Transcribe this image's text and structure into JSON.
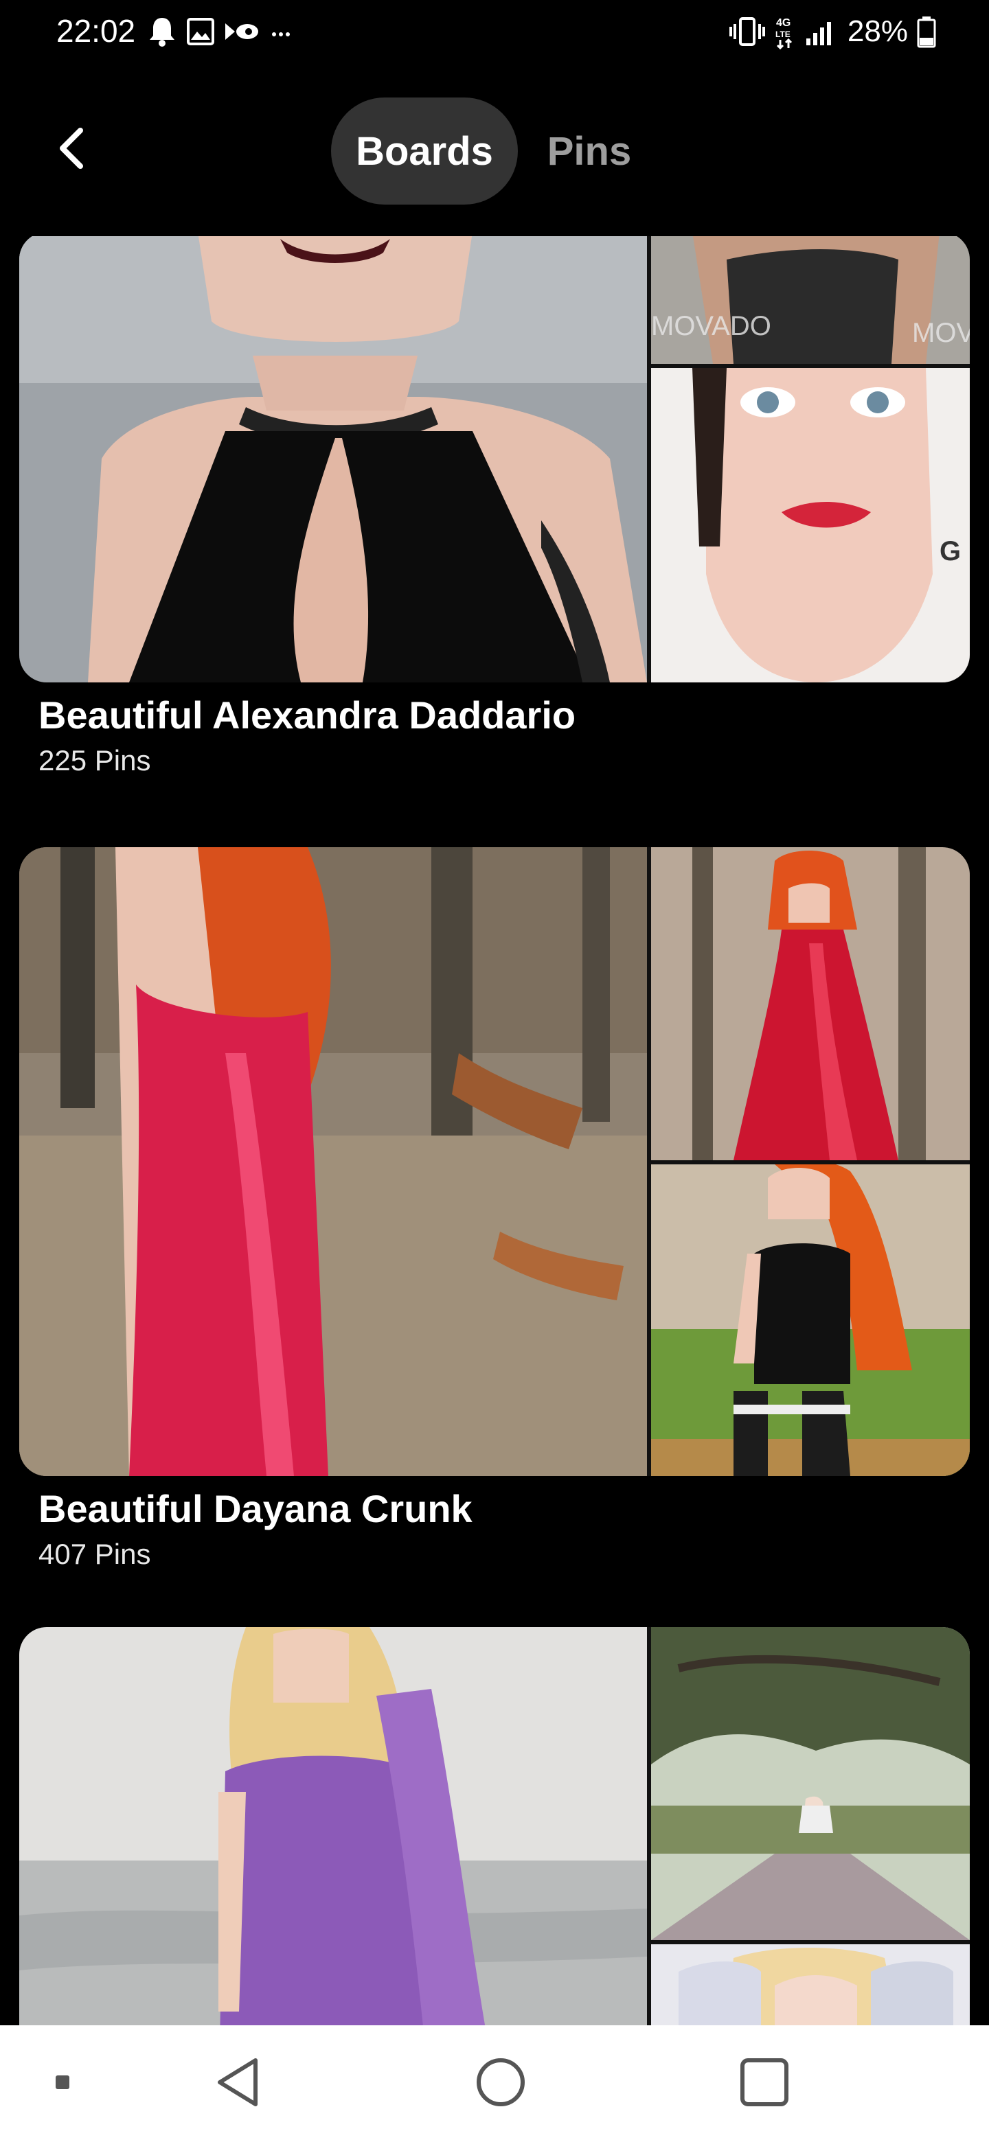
{
  "status_bar": {
    "time": "22:02",
    "battery_percent": "28%",
    "left_icons": [
      "notification-bell-icon",
      "gallery-icon",
      "cast-icon",
      "more-notifications-icon"
    ],
    "right_icons": [
      "vibrate-icon",
      "4g-lte-icon",
      "signal-icon",
      "battery-icon"
    ]
  },
  "header": {
    "back_icon": "chevron-left-icon",
    "tabs": [
      {
        "label": "Boards",
        "selected": true
      },
      {
        "label": "Pins",
        "selected": false
      }
    ]
  },
  "boards": [
    {
      "title": "Beautiful Alexandra Daddario",
      "count": "225 Pins"
    },
    {
      "title": "Beautiful Dayana Crunk",
      "count": "407 Pins"
    },
    {
      "title": "",
      "count": ""
    }
  ],
  "nav_bar": {
    "buttons": [
      "recent-apps-dot-icon",
      "back-triangle-icon",
      "home-circle-icon",
      "overview-square-icon"
    ]
  },
  "colors": {
    "background": "#000000",
    "selected_tab_bg": "#333333",
    "unselected_tab_text": "#9e9e9e",
    "nav_bar_bg": "#ffffff"
  }
}
